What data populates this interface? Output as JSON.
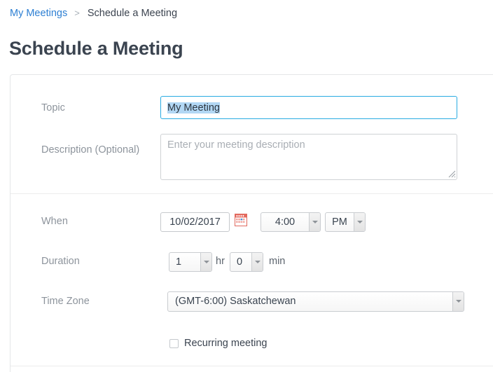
{
  "breadcrumb": {
    "parent_label": "My Meetings",
    "separator": ">",
    "current_label": "Schedule a Meeting"
  },
  "page": {
    "title": "Schedule a Meeting"
  },
  "form": {
    "topic": {
      "label": "Topic",
      "value": "My Meeting",
      "selected": true,
      "focus_border_color": "#29abe2",
      "selection_color": "#b2d7f4"
    },
    "description": {
      "label": "Description (Optional)",
      "value": "",
      "placeholder": "Enter your meeting description",
      "resize_handle_icon": "resize-grip-icon"
    },
    "when": {
      "label": "When",
      "date_value": "10/02/2017",
      "calendar_icon": "calendar-icon",
      "time_value": "4:00",
      "meridiem_value": "PM"
    },
    "duration": {
      "label": "Duration",
      "hours_value": "1",
      "hours_unit": "hr",
      "minutes_value": "0",
      "minutes_unit": "min"
    },
    "timezone": {
      "label": "Time Zone",
      "value": "(GMT-6:00) Saskatchewan"
    },
    "recurring": {
      "label": "Recurring meeting",
      "checked": false
    }
  },
  "colors": {
    "link": "#2d7fd3",
    "title_text": "#3b4450",
    "label_text": "#8d949c",
    "panel_border": "#e4e6e8",
    "divider": "#ececec",
    "calendar_icon_red": "#e4685d"
  }
}
